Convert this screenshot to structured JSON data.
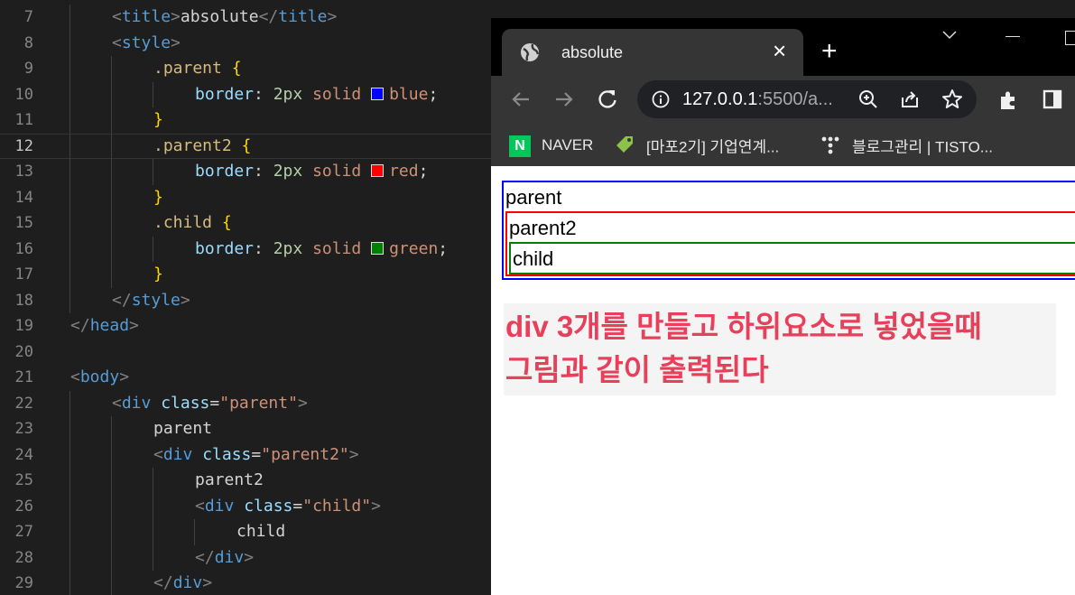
{
  "editor": {
    "lines": [
      {
        "no": "7",
        "indent": 1,
        "tokens": [
          [
            "pun",
            "<"
          ],
          [
            "tag",
            "title"
          ],
          [
            "pun",
            ">"
          ],
          [
            "txt",
            "absolute"
          ],
          [
            "pun",
            "</"
          ],
          [
            "tag",
            "title"
          ],
          [
            "pun",
            ">"
          ]
        ]
      },
      {
        "no": "8",
        "indent": 1,
        "tokens": [
          [
            "pun",
            "<"
          ],
          [
            "tag",
            "style"
          ],
          [
            "pun",
            ">"
          ]
        ]
      },
      {
        "no": "9",
        "indent": 2,
        "tokens": [
          [
            "sel",
            ".parent "
          ],
          [
            "brace",
            "{"
          ]
        ]
      },
      {
        "no": "10",
        "indent": 3,
        "tokens": [
          [
            "prop",
            "border"
          ],
          [
            "txt",
            ": "
          ],
          [
            "num",
            "2px"
          ],
          [
            "val",
            " solid "
          ],
          [
            "swatch",
            "#0000ff"
          ],
          [
            "val",
            "blue"
          ],
          [
            "txt",
            ";"
          ]
        ]
      },
      {
        "no": "11",
        "indent": 2,
        "tokens": [
          [
            "brace",
            "}"
          ]
        ]
      },
      {
        "no": "12",
        "indent": 2,
        "active": true,
        "tokens": [
          [
            "sel",
            ".parent2 "
          ],
          [
            "brace",
            "{"
          ]
        ]
      },
      {
        "no": "13",
        "indent": 3,
        "tokens": [
          [
            "prop",
            "border"
          ],
          [
            "txt",
            ": "
          ],
          [
            "num",
            "2px"
          ],
          [
            "val",
            " solid "
          ],
          [
            "swatch",
            "#ff0000"
          ],
          [
            "val",
            "red"
          ],
          [
            "txt",
            ";"
          ]
        ]
      },
      {
        "no": "14",
        "indent": 2,
        "tokens": [
          [
            "brace",
            "}"
          ]
        ]
      },
      {
        "no": "15",
        "indent": 2,
        "tokens": [
          [
            "sel",
            ".child "
          ],
          [
            "brace",
            "{"
          ]
        ]
      },
      {
        "no": "16",
        "indent": 3,
        "tokens": [
          [
            "prop",
            "border"
          ],
          [
            "txt",
            ": "
          ],
          [
            "num",
            "2px"
          ],
          [
            "val",
            " solid "
          ],
          [
            "swatch",
            "#008000"
          ],
          [
            "val",
            "green"
          ],
          [
            "txt",
            ";"
          ]
        ]
      },
      {
        "no": "17",
        "indent": 2,
        "tokens": [
          [
            "brace",
            "}"
          ]
        ]
      },
      {
        "no": "18",
        "indent": 1,
        "tokens": [
          [
            "pun",
            "</"
          ],
          [
            "tag",
            "style"
          ],
          [
            "pun",
            ">"
          ]
        ]
      },
      {
        "no": "19",
        "indent": 0,
        "tokens": [
          [
            "pun",
            "</"
          ],
          [
            "tag",
            "head"
          ],
          [
            "pun",
            ">"
          ]
        ]
      },
      {
        "no": "20",
        "indent": 0,
        "tokens": []
      },
      {
        "no": "21",
        "indent": 0,
        "tokens": [
          [
            "pun",
            "<"
          ],
          [
            "tag",
            "body"
          ],
          [
            "pun",
            ">"
          ]
        ]
      },
      {
        "no": "22",
        "indent": 1,
        "tokens": [
          [
            "pun",
            "<"
          ],
          [
            "tag",
            "div"
          ],
          [
            "attr",
            " class"
          ],
          [
            "txt",
            "="
          ],
          [
            "str",
            "\"parent\""
          ],
          [
            "pun",
            ">"
          ]
        ]
      },
      {
        "no": "23",
        "indent": 2,
        "tokens": [
          [
            "txt",
            "parent"
          ]
        ]
      },
      {
        "no": "24",
        "indent": 2,
        "tokens": [
          [
            "pun",
            "<"
          ],
          [
            "tag",
            "div"
          ],
          [
            "attr",
            " class"
          ],
          [
            "txt",
            "="
          ],
          [
            "str",
            "\"parent2\""
          ],
          [
            "pun",
            ">"
          ]
        ]
      },
      {
        "no": "25",
        "indent": 3,
        "tokens": [
          [
            "txt",
            "parent2"
          ]
        ]
      },
      {
        "no": "26",
        "indent": 3,
        "tokens": [
          [
            "pun",
            "<"
          ],
          [
            "tag",
            "div"
          ],
          [
            "attr",
            " class"
          ],
          [
            "txt",
            "="
          ],
          [
            "str",
            "\"child\""
          ],
          [
            "pun",
            ">"
          ]
        ]
      },
      {
        "no": "27",
        "indent": 4,
        "tokens": [
          [
            "txt",
            "child"
          ]
        ]
      },
      {
        "no": "28",
        "indent": 3,
        "tokens": [
          [
            "pun",
            "</"
          ],
          [
            "tag",
            "div"
          ],
          [
            "pun",
            ">"
          ]
        ]
      },
      {
        "no": "29",
        "indent": 2,
        "tokens": [
          [
            "pun",
            "</"
          ],
          [
            "tag",
            "div"
          ],
          [
            "pun",
            ">"
          ]
        ]
      }
    ]
  },
  "browser": {
    "tab_title": "absolute",
    "tab_close": "×",
    "new_tab": "+",
    "url_host": "127.0.0.1",
    "url_rest": ":5500/a...",
    "bookmarks": [
      {
        "label": "NAVER",
        "icon": "naver-icon"
      },
      {
        "label": "[마포2기] 기업연계...",
        "icon": "tag-icon"
      },
      {
        "label": "블로그관리 | TISTO...",
        "icon": "tistory-icon"
      }
    ]
  },
  "page": {
    "parent": "parent",
    "parent2": "parent2",
    "child": "child",
    "note_line1": "div 3개를 만들고 하위요소로 넣었을때",
    "note_line2": "그림과 같이 출력된다"
  },
  "colors": {
    "parent_border": "#0000ff",
    "parent2_border": "#ff0000",
    "child_border": "#008000",
    "note_text": "#e8405a"
  }
}
